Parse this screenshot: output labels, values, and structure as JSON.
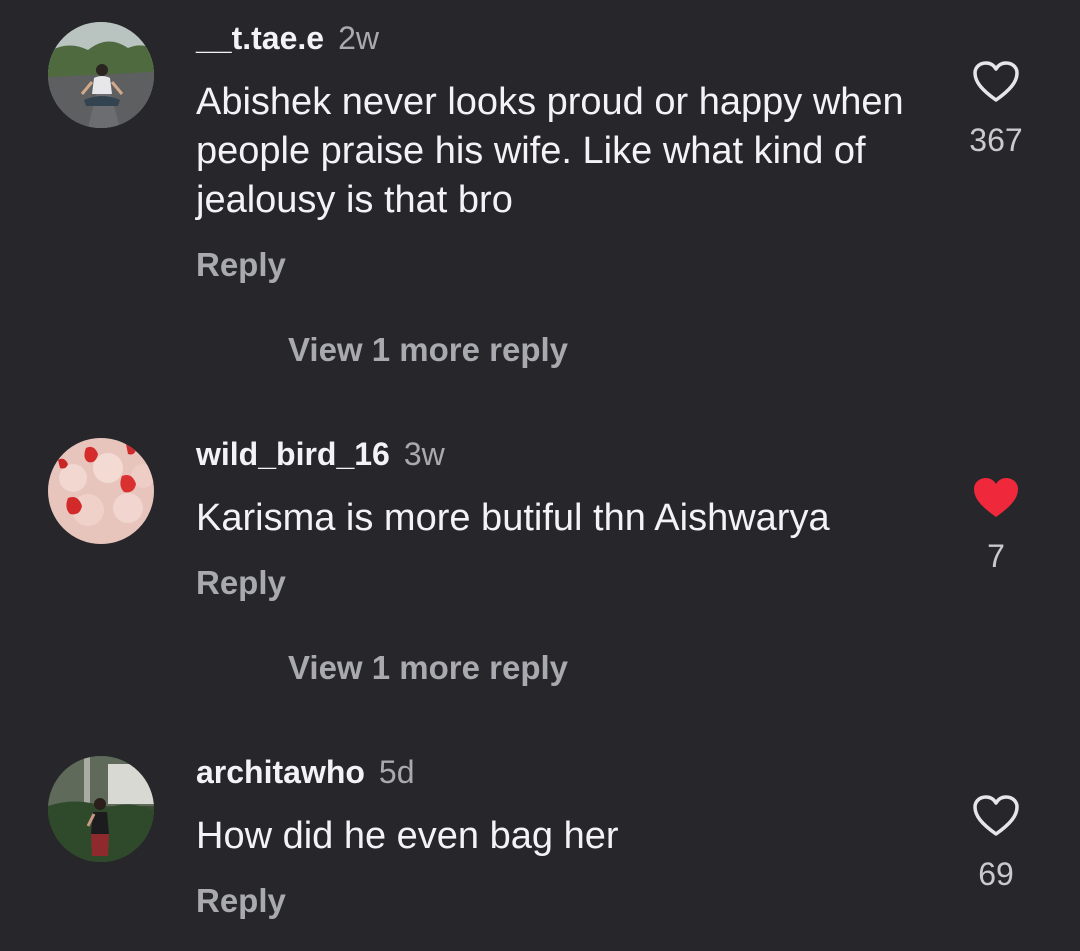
{
  "comments": [
    {
      "username": "__t.tae.e",
      "time": "2w",
      "text": "Abishek never looks proud or happy when people praise his wife. Like what kind of jealousy is that bro",
      "reply_label": "Reply",
      "view_more_label": "View 1 more reply",
      "like_count": "367",
      "liked": false,
      "avatar_icon": "person-meditating-on-road-avatar"
    },
    {
      "username": "wild_bird_16",
      "time": "3w",
      "text": "Karisma is more butiful thn Aishwarya",
      "reply_label": "Reply",
      "view_more_label": "View 1 more reply",
      "like_count": "7",
      "liked": true,
      "avatar_icon": "strawberry-cake-avatar"
    },
    {
      "username": "architawho",
      "time": "5d",
      "text": "How did he even bag her",
      "reply_label": "Reply",
      "like_count": "69",
      "liked": false,
      "avatar_icon": "person-standing-outdoors-avatar"
    }
  ],
  "colors": {
    "background": "#27272b",
    "primary_text": "#f3f3f5",
    "secondary_text": "#a9a9b0",
    "liked_heart": "#f0283c"
  }
}
